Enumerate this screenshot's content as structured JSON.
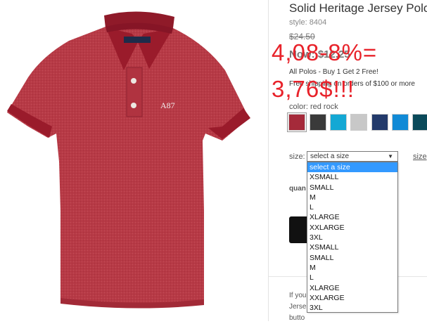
{
  "product": {
    "title": "Solid Heritage Jersey Polo",
    "style": "style: 8404",
    "old_price": "$24.50",
    "now_price": "Now: $12.25",
    "promo_line1": "All Polos - Buy 1 Get 2 Free!",
    "promo_line2": "Free shipping on orders of $100 or more",
    "color_label": "color: red rock",
    "logo_text": "A87"
  },
  "overlay": {
    "line1": "4,08-8%=",
    "line2": "3,76$!!!"
  },
  "colors": {
    "overlay": "#e8222a",
    "shirt_body": "#b83a45",
    "shirt_collar": "#9a1b2b",
    "dropdown_highlight": "#3399ff"
  },
  "swatches": [
    {
      "name": "red rock",
      "color": "#a52a3a"
    },
    {
      "name": "charcoal",
      "color": "#3a3a3a"
    },
    {
      "name": "teal blue",
      "color": "#14a8d4"
    },
    {
      "name": "light heather grey",
      "color": "#c8c8c8"
    },
    {
      "name": "navy",
      "color": "#233a6b"
    },
    {
      "name": "bright blue",
      "color": "#118ad6"
    },
    {
      "name": "dark teal",
      "color": "#0a4a5a"
    }
  ],
  "size": {
    "label": "size:",
    "right_label": "size",
    "selected": "select a size",
    "options": [
      "select a size",
      "XSMALL",
      "SMALL",
      "M",
      "L",
      "XLARGE",
      "XXLARGE",
      "3XL",
      "XSMALL",
      "SMALL",
      "M",
      "L",
      "XLARGE",
      "XXLARGE",
      "3XL"
    ]
  },
  "quantity": {
    "label": "quan"
  },
  "description": {
    "line1": "If you                      ed duds, l",
    "line2": "Jerse                        tra-soft f",
    "line3": "butto                              "
  }
}
